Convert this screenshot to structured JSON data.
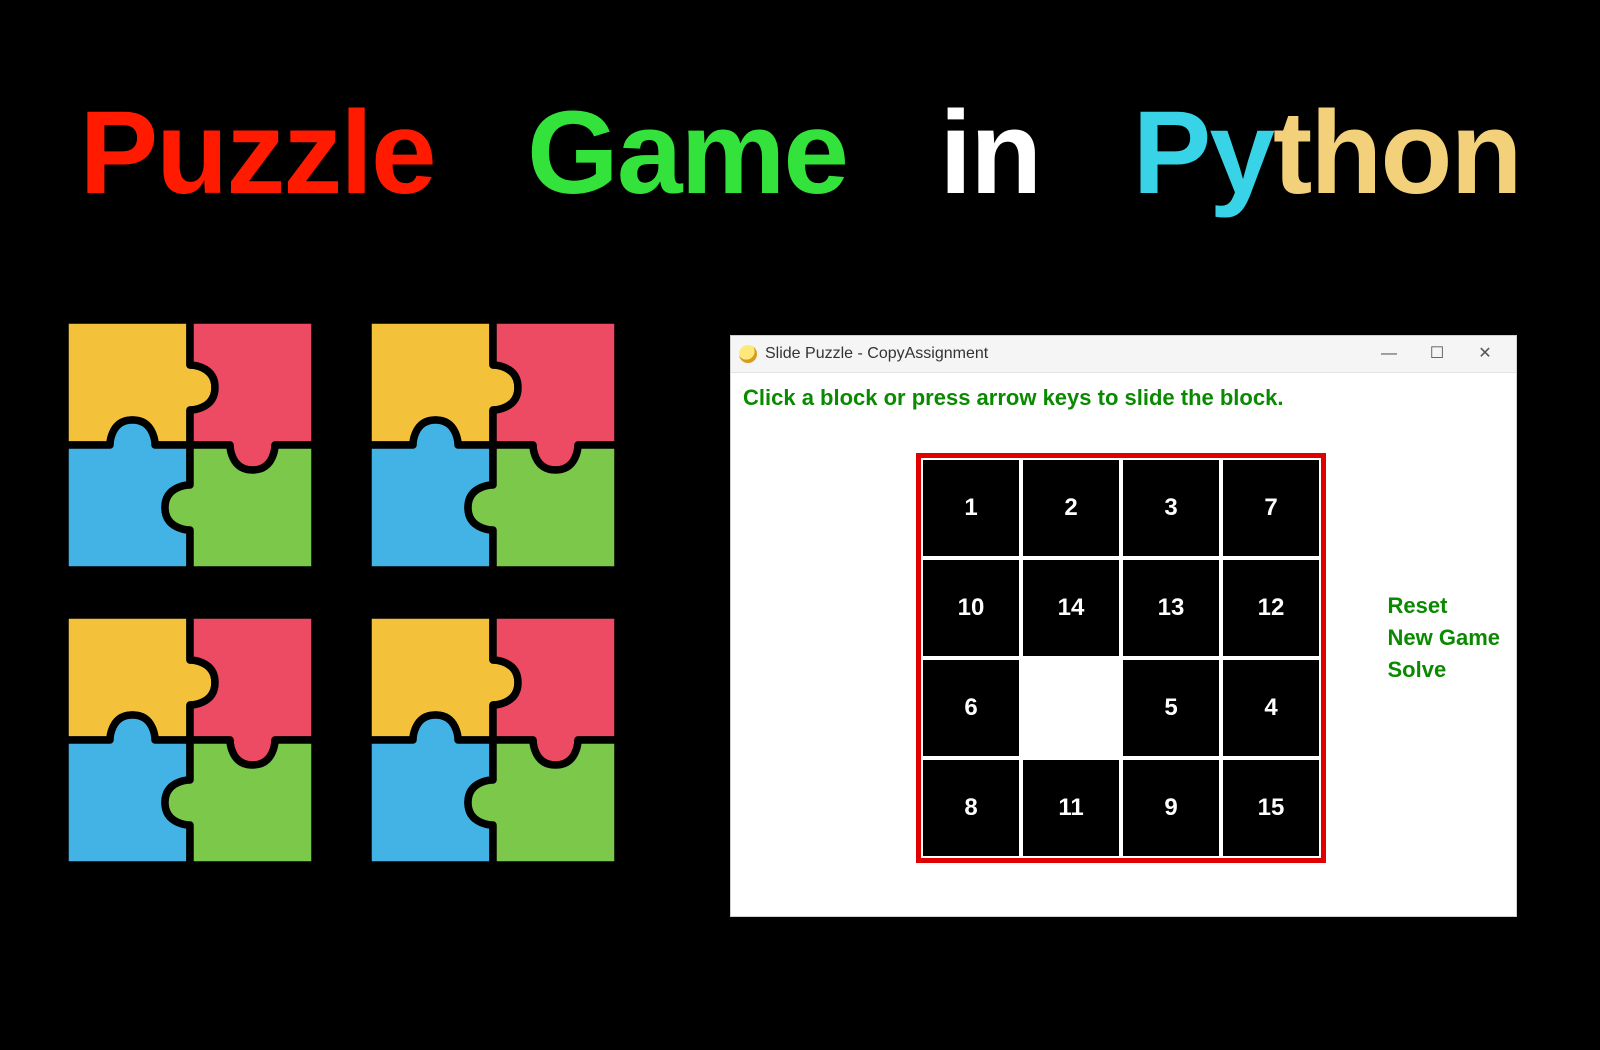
{
  "title": {
    "w1": "Puzzle",
    "w2": "Game",
    "w3": "in",
    "w4a": "Py",
    "w4b": "thon"
  },
  "jigsaw": {
    "colors": {
      "tl": "#f3c23a",
      "tr": "#ec4b63",
      "bl": "#43b3e6",
      "br": "#7cc84b",
      "stroke": "#000000"
    }
  },
  "app": {
    "window_title": "Slide Puzzle - CopyAssignment",
    "instruction": "Click a block or press arrow keys to slide the block.",
    "menu": {
      "reset": "Reset",
      "new_game": "New Game",
      "solve": "Solve"
    },
    "board": [
      [
        "1",
        "2",
        "3",
        "7"
      ],
      [
        "10",
        "14",
        "13",
        "12"
      ],
      [
        "6",
        "",
        "5",
        "4"
      ],
      [
        "8",
        "11",
        "9",
        "15"
      ]
    ]
  }
}
